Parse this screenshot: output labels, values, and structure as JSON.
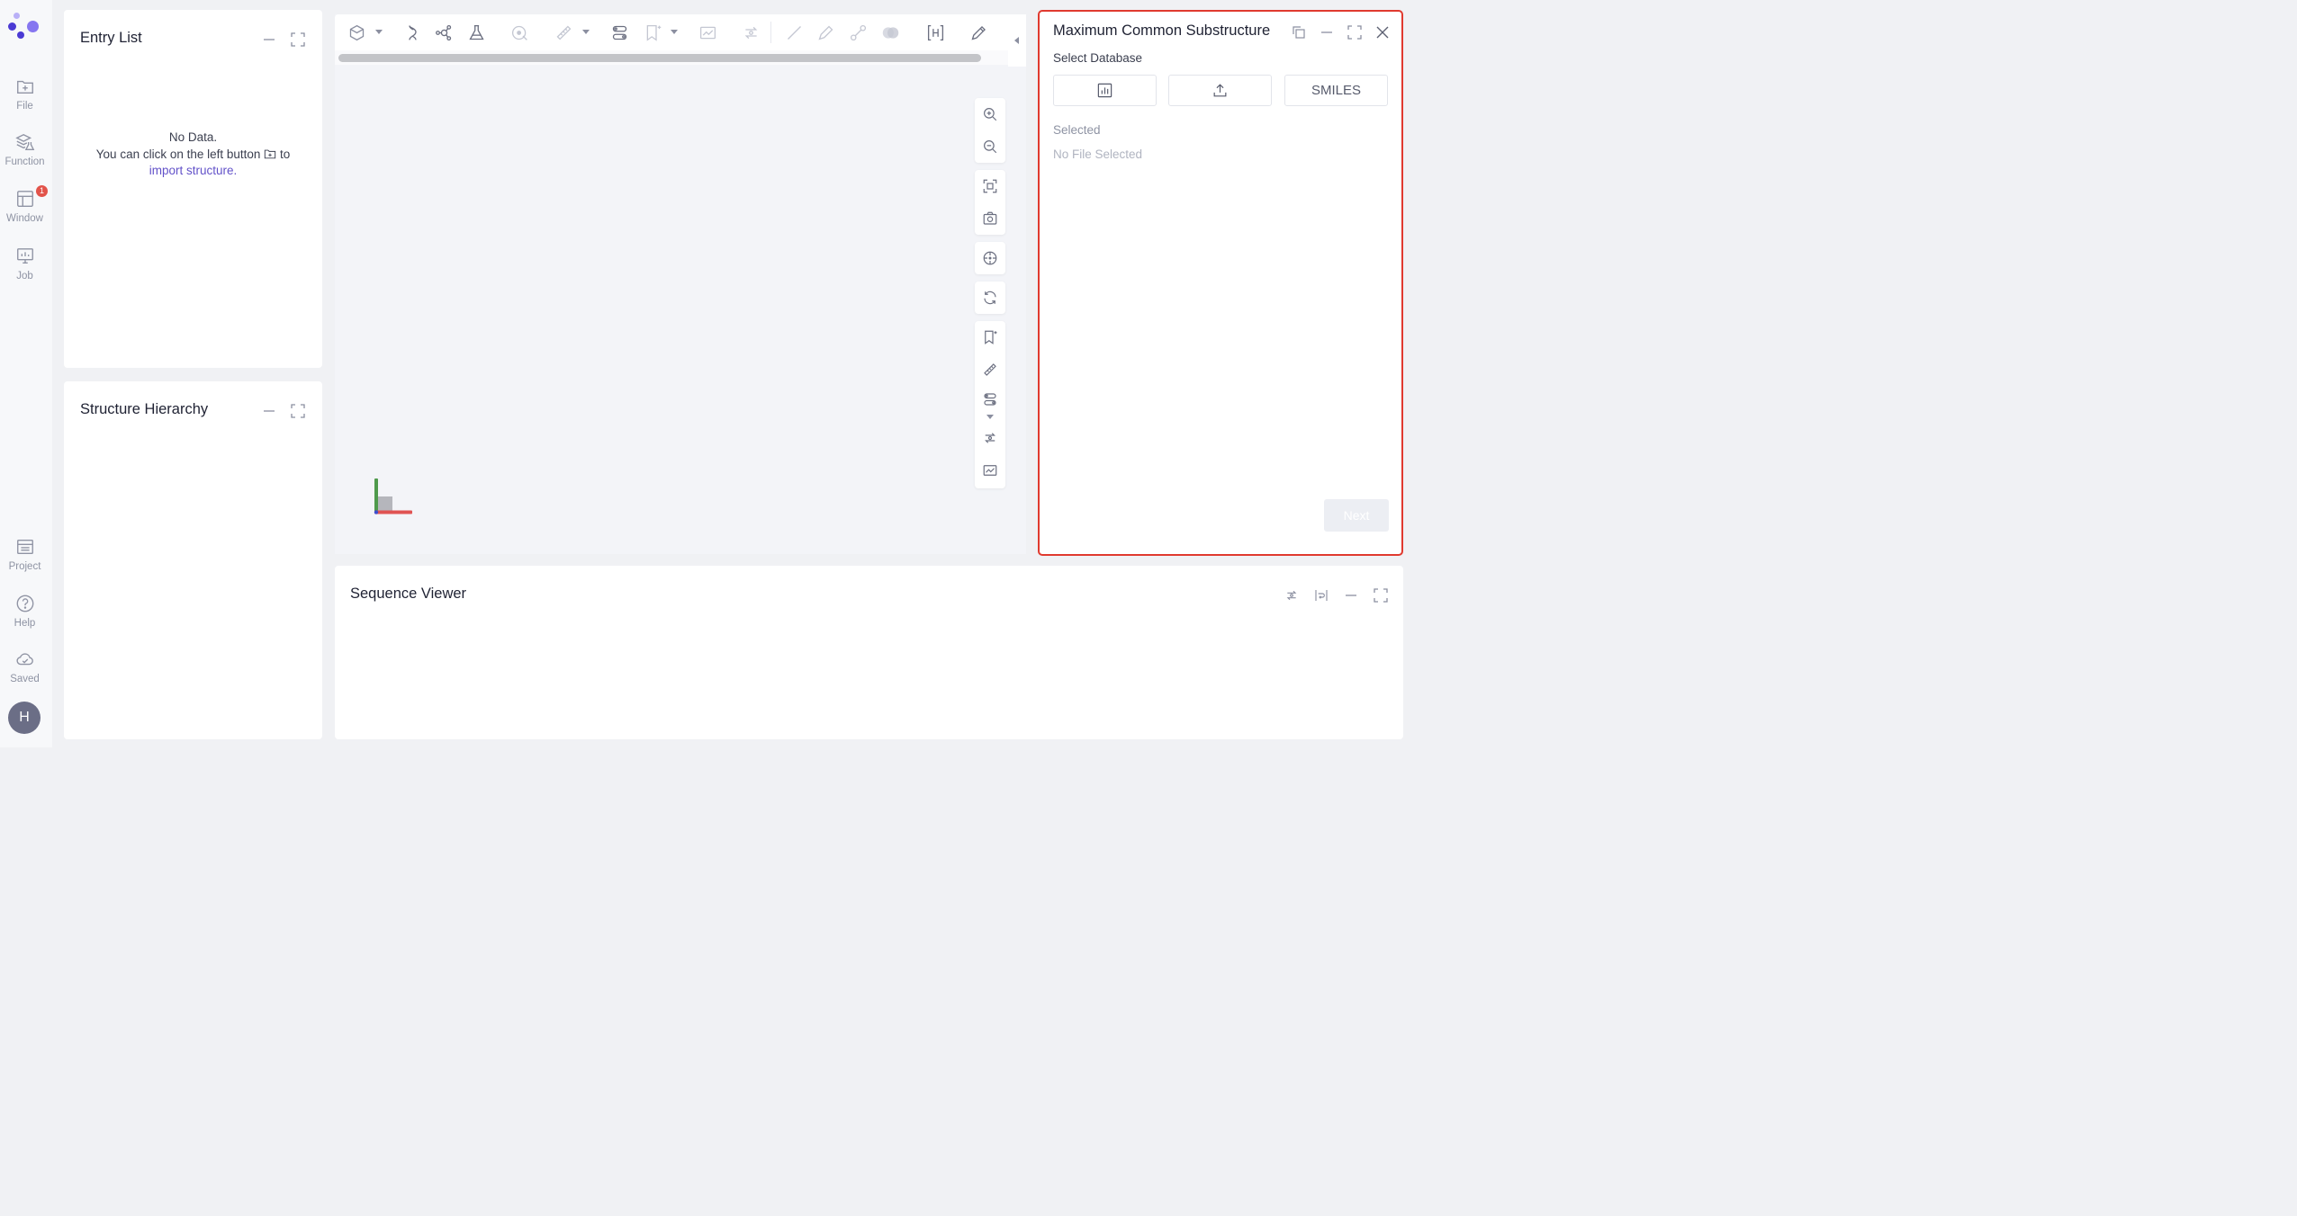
{
  "sidebar": {
    "items": [
      {
        "label": "File",
        "icon": "file-add-icon"
      },
      {
        "label": "Function",
        "icon": "layers-flask-icon"
      },
      {
        "label": "Window",
        "icon": "layout-icon",
        "badge": "1"
      },
      {
        "label": "Job",
        "icon": "monitor-chart-icon"
      }
    ],
    "bottom_items": [
      {
        "label": "Project",
        "icon": "list-icon"
      },
      {
        "label": "Help",
        "icon": "help-circle-icon"
      },
      {
        "label": "Saved",
        "icon": "cloud-icon"
      }
    ],
    "avatar_initial": "H"
  },
  "entry_list": {
    "title": "Entry List",
    "empty_line1": "No Data.",
    "empty_line2_prefix": "You can click on the left button",
    "empty_line2_suffix": "to",
    "empty_link": "import structure."
  },
  "structure_hierarchy": {
    "title": "Structure Hierarchy"
  },
  "mcs_panel": {
    "title": "Maximum Common Substructure",
    "select_database_label": "Select Database",
    "database_options": [
      {
        "type": "icon",
        "icon": "database-chart-icon"
      },
      {
        "type": "icon",
        "icon": "upload-icon"
      },
      {
        "type": "text",
        "label": "SMILES"
      }
    ],
    "selected_label": "Selected",
    "selected_value": "No File Selected",
    "next_label": "Next"
  },
  "sequence_viewer": {
    "title": "Sequence Viewer"
  },
  "colors": {
    "accent": "#6352c9",
    "highlight_border": "#e03a2f",
    "badge": "#e2534a",
    "logo": [
      "#4b3ad4",
      "#8676f0",
      "#b9b0f7"
    ]
  }
}
